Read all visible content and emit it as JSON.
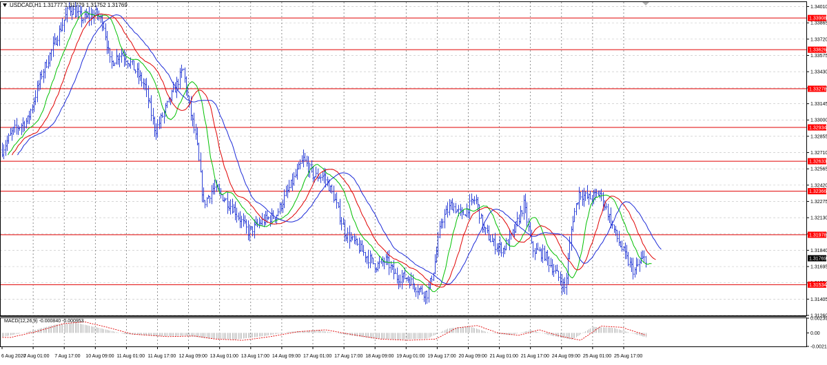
{
  "header": {
    "symbol_line": "USDCAD,H1  1.31777 1.31779 1.31752 1.31769"
  },
  "macd": {
    "label": "MACD(12,26,9) -0.000840 -0.000953",
    "ticks": [
      "0.002397",
      "0.00",
      "-0.00219"
    ]
  },
  "price_axis": {
    "ticks": [
      "1.34010",
      "1.33865",
      "1.33720",
      "1.33575",
      "1.33430",
      "1.33285",
      "1.33145",
      "1.33000",
      "1.32855",
      "1.32710",
      "1.32565",
      "1.32420",
      "1.32275",
      "1.32130",
      "1.31985",
      "1.31840",
      "1.31695",
      "1.31550",
      "1.31405",
      "1.31260"
    ],
    "levels": [
      "1.33908",
      "1.33626",
      "1.33278",
      "1.32934",
      "1.32633",
      "1.32366",
      "1.31978",
      "1.31534"
    ],
    "current": "1.31769"
  },
  "time_axis": {
    "labels": [
      "6 Aug 2020",
      "7 Aug 01:00",
      "7 Aug 17:00",
      "10 Aug 09:00",
      "11 Aug 01:00",
      "11 Aug 17:00",
      "12 Aug 09:00",
      "13 Aug 01:00",
      "13 Aug 17:00",
      "14 Aug 09:00",
      "17 Aug 01:00",
      "17 Aug 17:00",
      "18 Aug 09:00",
      "19 Aug 01:00",
      "19 Aug 17:00",
      "20 Aug 09:00",
      "21 Aug 01:00",
      "21 Aug 17:00",
      "24 Aug 09:00",
      "25 Aug 01:00",
      "25 Aug 17:00"
    ]
  },
  "colors": {
    "price_bars": "#2b3fd6",
    "ma_fast": "#00c000",
    "ma_mid": "#e00000",
    "ma_slow": "#1c2ad8",
    "level_line": "#e00000",
    "level_tag": "#ff0000",
    "macd_hist": "#b8b8b8",
    "macd_signal": "#e00000",
    "grid": "#c8c8c8"
  },
  "chart_data": {
    "type": "line",
    "ylim": [
      1.3126,
      1.3405
    ],
    "anchors": [
      [
        0,
        1.327
      ],
      [
        18,
        1.329
      ],
      [
        40,
        1.33
      ],
      [
        60,
        1.334
      ],
      [
        80,
        1.337
      ],
      [
        100,
        1.34
      ],
      [
        120,
        1.339
      ],
      [
        140,
        1.3395
      ],
      [
        150,
        1.3385
      ],
      [
        160,
        1.335
      ],
      [
        175,
        1.336
      ],
      [
        190,
        1.335
      ],
      [
        210,
        1.333
      ],
      [
        225,
        1.329
      ],
      [
        240,
        1.331
      ],
      [
        255,
        1.333
      ],
      [
        265,
        1.3345
      ],
      [
        275,
        1.331
      ],
      [
        285,
        1.328
      ],
      [
        295,
        1.3225
      ],
      [
        310,
        1.324
      ],
      [
        325,
        1.323
      ],
      [
        340,
        1.322
      ],
      [
        360,
        1.32
      ],
      [
        380,
        1.321
      ],
      [
        400,
        1.3215
      ],
      [
        420,
        1.324
      ],
      [
        440,
        1.3265
      ],
      [
        455,
        1.325
      ],
      [
        470,
        1.325
      ],
      [
        485,
        1.323
      ],
      [
        500,
        1.32
      ],
      [
        515,
        1.319
      ],
      [
        530,
        1.318
      ],
      [
        545,
        1.317
      ],
      [
        560,
        1.3175
      ],
      [
        575,
        1.316
      ],
      [
        590,
        1.316
      ],
      [
        605,
        1.315
      ],
      [
        620,
        1.3145
      ],
      [
        630,
        1.317
      ],
      [
        640,
        1.321
      ],
      [
        655,
        1.3225
      ],
      [
        670,
        1.3215
      ],
      [
        690,
        1.323
      ],
      [
        700,
        1.3205
      ],
      [
        715,
        1.319
      ],
      [
        730,
        1.3185
      ],
      [
        745,
        1.32
      ],
      [
        760,
        1.3225
      ],
      [
        772,
        1.3185
      ],
      [
        790,
        1.318
      ],
      [
        810,
        1.316
      ],
      [
        820,
        1.315
      ],
      [
        830,
        1.321
      ],
      [
        840,
        1.3235
      ],
      [
        855,
        1.323
      ],
      [
        870,
        1.3235
      ],
      [
        880,
        1.322
      ],
      [
        895,
        1.3195
      ],
      [
        910,
        1.3175
      ],
      [
        920,
        1.3165
      ],
      [
        930,
        1.3175
      ],
      [
        937,
        1.3177
      ]
    ],
    "macd_anchors": [
      [
        0,
        -0.0008
      ],
      [
        40,
        0.0002
      ],
      [
        80,
        0.0015
      ],
      [
        110,
        0.0018
      ],
      [
        140,
        0.001
      ],
      [
        180,
        -0.0002
      ],
      [
        230,
        -0.0006
      ],
      [
        270,
        -0.0005
      ],
      [
        300,
        -0.001
      ],
      [
        340,
        -0.0012
      ],
      [
        380,
        -0.0006
      ],
      [
        420,
        0.0002
      ],
      [
        460,
        0.0005
      ],
      [
        500,
        -0.0003
      ],
      [
        540,
        -0.001
      ],
      [
        580,
        -0.0012
      ],
      [
        620,
        -0.001
      ],
      [
        650,
        0.0008
      ],
      [
        680,
        0.0012
      ],
      [
        710,
        0.0
      ],
      [
        740,
        -0.0004
      ],
      [
        770,
        0.0005
      ],
      [
        800,
        -0.0005
      ],
      [
        830,
        -0.0012
      ],
      [
        860,
        0.0011
      ],
      [
        890,
        0.0009
      ],
      [
        937,
        -0.0008
      ]
    ]
  }
}
